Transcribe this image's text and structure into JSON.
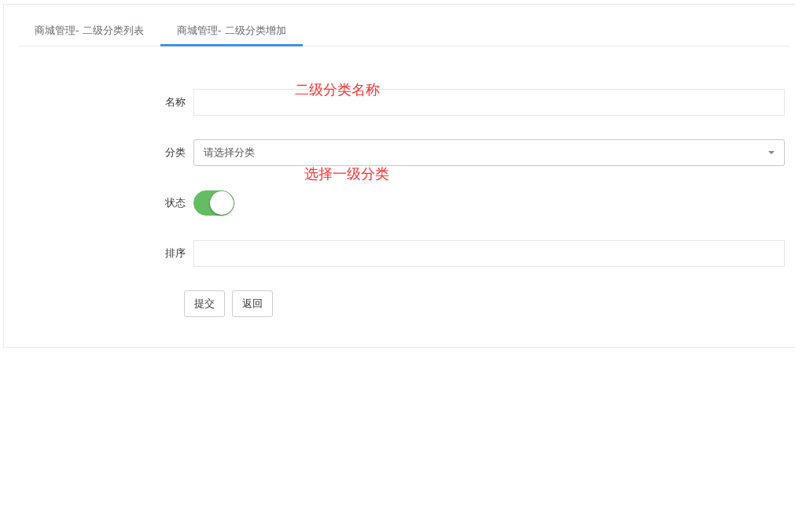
{
  "tabs": [
    {
      "label": "商城管理- 二级分类列表",
      "selected": false
    },
    {
      "label": "商城管理- 二级分类增加",
      "selected": true
    }
  ],
  "form": {
    "fields": [
      {
        "kind": "text",
        "label": "名称",
        "annotation": "二级分类名称"
      },
      {
        "kind": "select",
        "label": "分类",
        "value": "请选择分类",
        "annotation": "选择一级分类"
      },
      {
        "kind": "switch",
        "label": "状态",
        "on": true
      },
      {
        "kind": "text",
        "label": "排序"
      }
    ],
    "buttons": [
      "提交",
      "返回"
    ]
  }
}
